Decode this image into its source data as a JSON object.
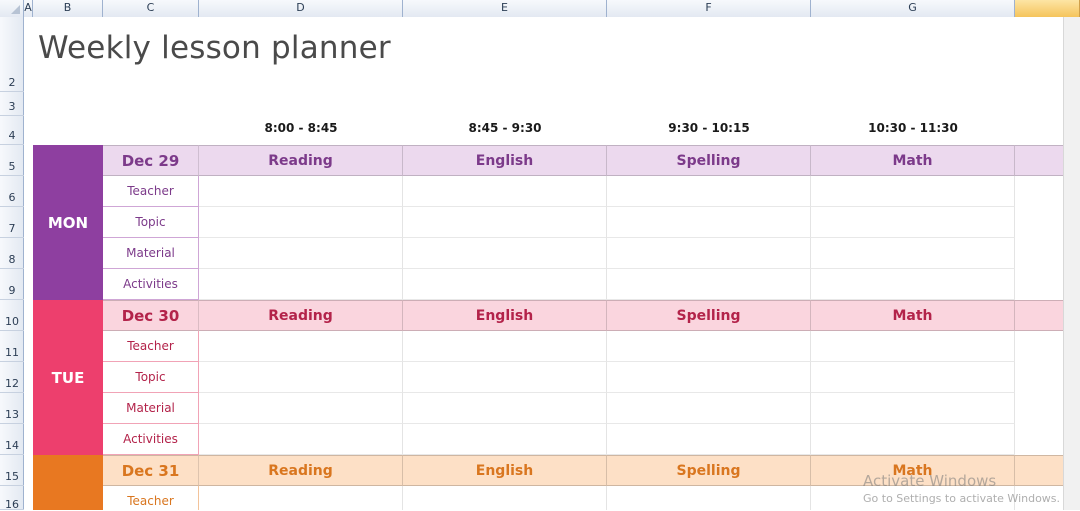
{
  "columns": [
    "A",
    "B",
    "C",
    "D",
    "E",
    "F",
    "G"
  ],
  "rows": [
    "2",
    "3",
    "4",
    "5",
    "6",
    "7",
    "8",
    "9",
    "10",
    "11",
    "12",
    "13",
    "14",
    "15",
    "16"
  ],
  "title": "Weekly lesson planner",
  "time_slots": [
    "8:00 - 8:45",
    "8:45 - 9:30",
    "9:30 - 10:15",
    "10:30 - 11:30"
  ],
  "labels": [
    "Teacher",
    "Topic",
    "Material",
    "Activities"
  ],
  "days": [
    {
      "day": "MON",
      "date": "Dec 29",
      "subjects": [
        "Reading",
        "English",
        "Spelling",
        "Math"
      ]
    },
    {
      "day": "TUE",
      "date": "Dec 30",
      "subjects": [
        "Reading",
        "English",
        "Spelling",
        "Math"
      ]
    },
    {
      "day": "",
      "date": "Dec 31",
      "subjects": [
        "Reading",
        "English",
        "Spelling",
        "Math"
      ]
    }
  ],
  "wed_label_first": "Teacher",
  "watermark": {
    "title": "Activate Windows",
    "subtitle": "Go to Settings to activate Windows."
  },
  "colors": {
    "mon": "#8e3fa0",
    "tue": "#ed3f6d",
    "wed": "#e87821"
  }
}
